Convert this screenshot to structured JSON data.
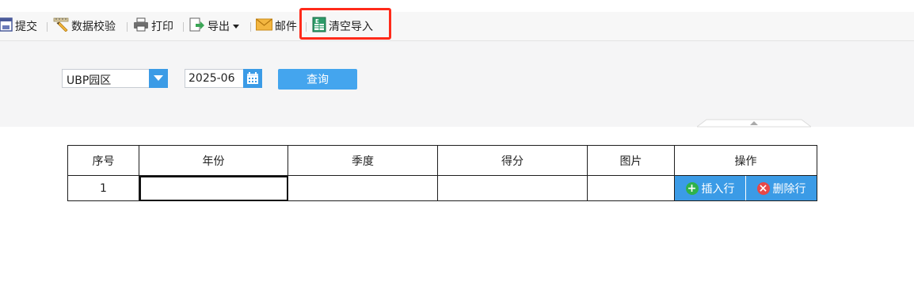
{
  "toolbar": {
    "items": [
      {
        "label": "提交",
        "icon": "submit-icon"
      },
      {
        "label": "数据校验",
        "icon": "pencil-ruler-icon"
      },
      {
        "label": "打印",
        "icon": "printer-icon"
      },
      {
        "label": "导出",
        "icon": "export-icon",
        "has_dropdown": true
      },
      {
        "label": "邮件",
        "icon": "mail-icon"
      },
      {
        "label": "清空导入",
        "icon": "excel-clear-icon",
        "highlighted": true
      }
    ]
  },
  "query": {
    "park_select": {
      "value": "UBP园区"
    },
    "date_field": {
      "value": "2025-06"
    },
    "query_button": "查询"
  },
  "table": {
    "columns": [
      "序号",
      "年份",
      "季度",
      "得分",
      "图片",
      "操作"
    ],
    "rows": [
      {
        "index": "1",
        "year": "",
        "quarter": "",
        "score": "",
        "image": ""
      }
    ],
    "actions": {
      "insert": "插入行",
      "delete": "删除行"
    }
  },
  "colors": {
    "accent": "#3b9be6",
    "highlight": "#ff2a1a",
    "insert_icon": "#2fb24a",
    "delete_icon": "#e84848"
  }
}
